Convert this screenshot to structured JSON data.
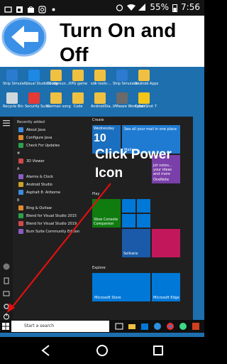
{
  "status": {
    "battery": "55%",
    "time": "7:56"
  },
  "header": {
    "title_line1": "Turn On and",
    "title_line2": "Off"
  },
  "overlay": {
    "line1": "Click Power",
    "line2": "Icon"
  },
  "desktop_icons": [
    {
      "label": "Ship Simulat...",
      "color": "#2b7bd0"
    },
    {
      "label": "Visual Studio Code",
      "color": "#1e88e5"
    },
    {
      "label": "Backgroun...",
      "color": "#f0c040"
    },
    {
      "label": "RPG game",
      "color": "#f0c040"
    },
    {
      "label": "sdk-tools-...",
      "color": "#f0c040"
    },
    {
      "label": "Ship Simulator...",
      "color": "#2b7bd0"
    },
    {
      "label": "Android Apps",
      "color": "#f0c040"
    },
    {
      "label": "Recycle Bin",
      "color": "#cfd8dc"
    },
    {
      "label": "Security Suite",
      "color": "#e53935"
    },
    {
      "label": "German song",
      "color": "#f0c040"
    },
    {
      "label": "Code",
      "color": "#f0c040"
    },
    {
      "label": "AndroidSta...",
      "color": "#f0c040"
    },
    {
      "label": "VMware Workstati...",
      "color": "#6a6a6a"
    },
    {
      "label": "CyberShot 7",
      "color": "#f5c518"
    }
  ],
  "start_menu": {
    "recent_heading": "Recently added",
    "recent": [
      "About Java",
      "Configure Java",
      "Check For Updates"
    ],
    "sections": [
      {
        "letter": "#",
        "items": [
          "3D Viewer"
        ]
      },
      {
        "letter": "A",
        "items": [
          "Alarms & Clock",
          "Android Studio",
          "Asphalt 8: Airborne"
        ]
      },
      {
        "letter": "B",
        "items": [
          "Bing & Outlaw",
          "Blend for Visual Studio 2015",
          "Blend for Visual Studio 2019",
          "Bum Suite Community Edition"
        ]
      }
    ],
    "tile_groups": [
      "Create",
      "Play",
      "Explore"
    ],
    "tiles": {
      "calendar_day": "Wednesday",
      "calendar_date": "10",
      "mail_text": "See all your mail in one place",
      "mail_label": "Mail",
      "onenote_text": "Jot notes... your ideas and more",
      "onenote_label": "OneNote",
      "xbox_label": "Xbox Console Companion",
      "solitaire_label": "Solitaire",
      "candy_label": "",
      "store_label": "Microsoft Store",
      "edge_label": "Microsoft Edge"
    }
  },
  "taskbar": {
    "search_placeholder": "Start a search"
  },
  "colors": {
    "arrow": "#e01010",
    "back_button": "#3a8fe6",
    "desktop_bg": "#1d6fae",
    "tile_blue": "#0078d7"
  }
}
